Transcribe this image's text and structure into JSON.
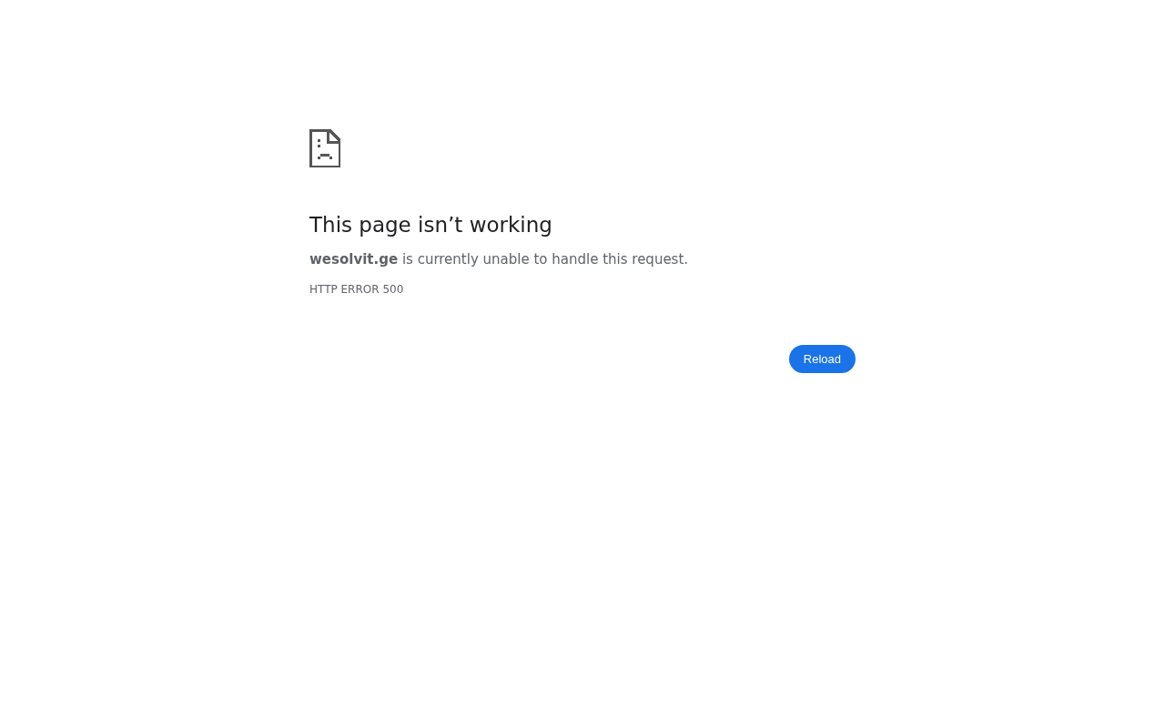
{
  "error": {
    "title": "This page isn’t working",
    "message": "**wesolvit.ge** is currently unable to handle this request.",
    "code": "HTTP ERROR 500"
  },
  "buttons": [
    {
      "label": "Reload",
      "kind": "primary"
    }
  ]
}
